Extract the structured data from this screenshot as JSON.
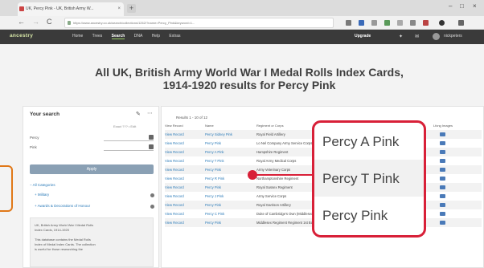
{
  "browser": {
    "tab_title": "UK, Percy Pink - UK, British Army W...",
    "tab_close": "×",
    "new_tab": "+",
    "window_controls": [
      "–",
      "□",
      "×"
    ],
    "nav_back": "←",
    "nav_forward": "→",
    "nav_reload": "C",
    "url": "https://www.ancestry.co.uk/search/collections/1262/?name=Percy_Pink&keyword=1..."
  },
  "site": {
    "logo": "ancestry",
    "nav": [
      "Home",
      "Trees",
      "Search",
      "DNA",
      "Help",
      "Extras"
    ],
    "active_nav": "Search",
    "upgrade": "Upgrade",
    "account": "nickpeters"
  },
  "page": {
    "title_line1": "All UK, British Army World War I Medal Rolls Index Cards,",
    "title_line2": "1914-1920 results for Percy Pink"
  },
  "sidebar": {
    "heading": "Your search",
    "subtext": "Exact ??? • Edit",
    "fields": [
      "Percy",
      "Pink"
    ],
    "search_button": "Apply",
    "categories": [
      "All Categories",
      "Military",
      "Awards & Decorations of Honour"
    ],
    "description": [
      "UK, British Army World War I Medal Rolls",
      "Index Cards, 1914-1920",
      "",
      "This database contains the Medal Rolls",
      "Index of Medal Index Cards. The collection",
      "is useful for those researching the"
    ]
  },
  "results": {
    "count": "Results 1 - 10 of 12",
    "headers": [
      "View Record",
      "Name",
      "Regiment or Corps",
      "Lfcng Images"
    ],
    "rows": [
      {
        "view": "View Record",
        "name": "Percy Sidney Pink",
        "regiment": "Royal Field Artillery",
        "extra": ""
      },
      {
        "view": "View Record",
        "name": "Percy Pink",
        "regiment": "Lo Nel Company Army Service Corps",
        "extra": ""
      },
      {
        "view": "View Record",
        "name": "Percy A Pink",
        "regiment": "Hampshire Regiment",
        "extra": ""
      },
      {
        "view": "View Record",
        "name": "Percy T Pink",
        "regiment": "Royal Army Medical Corps",
        "extra": ""
      },
      {
        "view": "View Record",
        "name": "Percy Pink",
        "regiment": "Army Veterinary Corps",
        "extra": ""
      },
      {
        "view": "View Record",
        "name": "Percy R Pink",
        "regiment": "Northamptonshire Regiment",
        "extra": ""
      },
      {
        "view": "View Record",
        "name": "Percy Pink",
        "regiment": "Royal Sussex Regiment",
        "extra": ""
      },
      {
        "view": "View Record",
        "name": "Percy J Pink",
        "regiment": "Army Service Corps",
        "extra": ""
      },
      {
        "view": "View Record",
        "name": "Percy Pink",
        "regiment": "Royal Garrison Artillery",
        "extra": ""
      },
      {
        "view": "View Record",
        "name": "Percy C Pink",
        "regiment": "Duke of Cambridge's Own (Middlesex Regiment)",
        "extra": "57965"
      },
      {
        "view": "View Record",
        "name": "Percy Pink",
        "regiment": "Middlesex Regiment Regiment 1st Batt.",
        "extra": "5186"
      }
    ]
  },
  "callout": {
    "items": [
      "Percy A Pink",
      "Percy T Pink",
      "Percy Pink"
    ]
  },
  "colors": {
    "highlight_red": "#d82038",
    "mark_orange": "#e07818",
    "link_blue": "#2a7ab8",
    "header_dark": "#3a3a3a"
  }
}
